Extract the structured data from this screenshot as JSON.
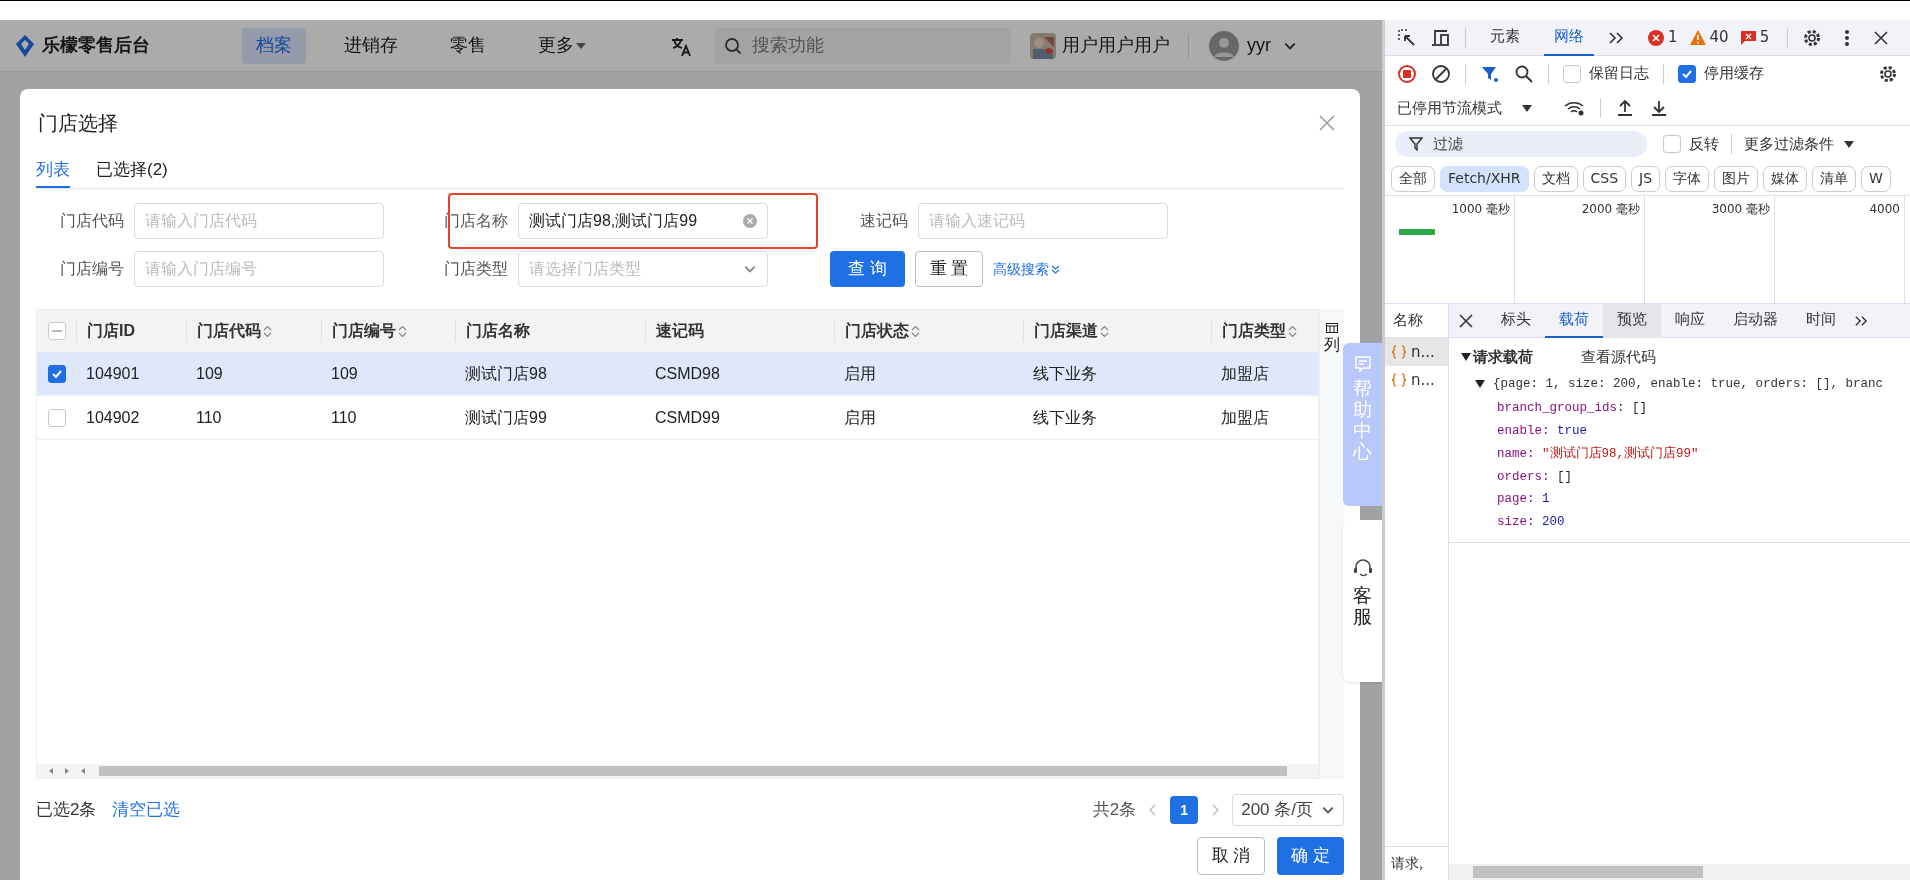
{
  "header": {
    "app_name": "乐檬零售后台",
    "nav": [
      {
        "label": "档案",
        "selected": true,
        "dropdown": false
      },
      {
        "label": "进销存",
        "selected": false,
        "dropdown": false
      },
      {
        "label": "零售",
        "selected": false,
        "dropdown": false
      },
      {
        "label": "更多",
        "selected": false,
        "dropdown": true
      }
    ],
    "search": {
      "placeholder": "搜索功能"
    },
    "company": "用户用户用户",
    "user": "yyr"
  },
  "modal": {
    "title": "门店选择",
    "tabs": [
      {
        "label": "列表",
        "selected": true
      },
      {
        "label": "已选择(2)",
        "selected": false
      }
    ],
    "filters": [
      {
        "label": "门店代码",
        "kind": "input",
        "placeholder": "请输入门店代码"
      },
      {
        "label": "门店名称",
        "kind": "input",
        "value": "测试门店98,测试门店99"
      },
      {
        "label": "速记码",
        "kind": "input",
        "placeholder": "请输入速记码"
      },
      {
        "label": "门店编号",
        "kind": "input",
        "placeholder": "请输入门店编号"
      },
      {
        "label": "门店类型",
        "kind": "select",
        "placeholder": "请选择门店类型"
      }
    ],
    "actions": {
      "query": "查 询",
      "reset": "重 置",
      "advanced": "高级搜索"
    },
    "table": {
      "columns": [
        {
          "label": "门店ID",
          "sortable": false
        },
        {
          "label": "门店代码",
          "sortable": true
        },
        {
          "label": "门店编号",
          "sortable": true
        },
        {
          "label": "门店名称",
          "sortable": false
        },
        {
          "label": "速记码",
          "sortable": false
        },
        {
          "label": "门店状态",
          "sortable": true
        },
        {
          "label": "门店渠道",
          "sortable": true
        },
        {
          "label": "门店类型",
          "sortable": true
        }
      ],
      "column_settings": "列",
      "header_checkbox": {
        "indeterminate": true
      },
      "rows": [
        {
          "selected": true,
          "cells": [
            "104901",
            "109",
            "109",
            "测试门店98",
            "CSMD98",
            "启用",
            "线下业务",
            "加盟店"
          ]
        },
        {
          "selected": false,
          "cells": [
            "104902",
            "110",
            "110",
            "测试门店99",
            "CSMD99",
            "启用",
            "线下业务",
            "加盟店"
          ]
        }
      ]
    },
    "footer": {
      "selected_count": "已选2条",
      "clear": "清空已选",
      "total": "共2条",
      "pages": [
        {
          "label": "1",
          "selected": true
        }
      ],
      "page_size": "200 条/页",
      "cancel": "取 消",
      "confirm": "确 定"
    }
  },
  "side_widgets": {
    "help": "帮助中心",
    "service": "客服"
  },
  "devtools": {
    "tabs": [
      {
        "label": "元素",
        "selected": false
      },
      {
        "label": "网络",
        "selected": true
      }
    ],
    "errors": "1",
    "warnings": "40",
    "issues": "5",
    "options": [
      {
        "label": "保留日志",
        "checked": false
      },
      {
        "label": "停用缓存",
        "checked": true
      }
    ],
    "throttling": "已停用节流模式",
    "filter": {
      "placeholder": "过滤",
      "invert": {
        "label": "反转",
        "checked": false
      },
      "more": "更多过滤条件"
    },
    "type_chips": [
      {
        "label": "全部",
        "selected": false
      },
      {
        "label": "Fetch/XHR",
        "selected": true
      },
      {
        "label": "文档",
        "selected": false
      },
      {
        "label": "CSS",
        "selected": false
      },
      {
        "label": "JS",
        "selected": false
      },
      {
        "label": "字体",
        "selected": false
      },
      {
        "label": "图片",
        "selected": false
      },
      {
        "label": "媒体",
        "selected": false
      },
      {
        "label": "清单",
        "selected": false
      },
      {
        "label": "W",
        "selected": false
      }
    ],
    "timeline_ticks": [
      "1000 毫秒",
      "2000 毫秒",
      "3000 毫秒",
      "4000"
    ],
    "requests_header": "名称",
    "requests": [
      {
        "name": "n...",
        "selected": true
      },
      {
        "name": "n...",
        "selected": false
      }
    ],
    "detail_tabs": [
      {
        "label": "标头",
        "selected": false,
        "hovered": false
      },
      {
        "label": "载荷",
        "selected": true,
        "hovered": false
      },
      {
        "label": "预览",
        "selected": false,
        "hovered": true
      },
      {
        "label": "响应",
        "selected": false,
        "hovered": false
      },
      {
        "label": "启动器",
        "selected": false,
        "hovered": false
      },
      {
        "label": "时间",
        "selected": false,
        "hovered": false
      }
    ],
    "payload": {
      "title": "请求载荷",
      "view_source": "查看源代码",
      "summary": "{page: 1, size: 200, enable: true, orders: [], branc",
      "properties": [
        {
          "key": "branch_group_ids:",
          "value": "[]",
          "kind": "array"
        },
        {
          "key": "enable:",
          "value": "true",
          "kind": "literal"
        },
        {
          "key": "name:",
          "value": "\"测试门店98,测试门店99\"",
          "kind": "string"
        },
        {
          "key": "orders:",
          "value": "[]",
          "kind": "array"
        },
        {
          "key": "page:",
          "value": "1",
          "kind": "literal"
        },
        {
          "key": "size:",
          "value": "200",
          "kind": "literal"
        }
      ]
    },
    "status": "请求,"
  }
}
